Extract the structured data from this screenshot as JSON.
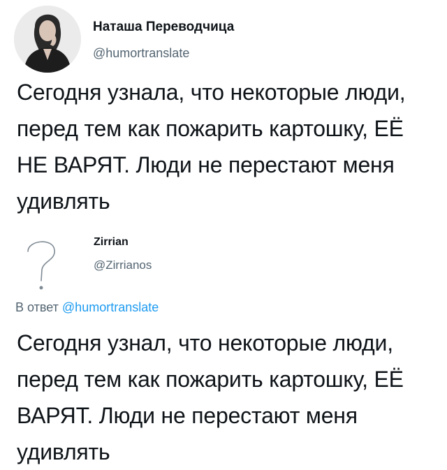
{
  "tweets": [
    {
      "author": {
        "name": "Наташа Переводчица",
        "handle": "@humortranslate"
      },
      "text": "Сегодня узнала, что некоторые люди, перед тем как пожарить картошку, ЕЁ НЕ ВАРЯТ. Люди не перестают меня удивлять"
    },
    {
      "author": {
        "name": "Zirrian",
        "handle": "@Zirrianos"
      },
      "reply_prefix": "В ответ",
      "reply_handle": "@humortranslate",
      "text": "Сегодня узнал, что некоторые люди, перед тем как пожарить картошку, ЕЁ ВАРЯТ. Люди не перестают меня удивлять"
    }
  ],
  "icons": {
    "tweet1_avatar": "user-photo-avatar",
    "tweet2_avatar": "question-mark-avatar"
  }
}
